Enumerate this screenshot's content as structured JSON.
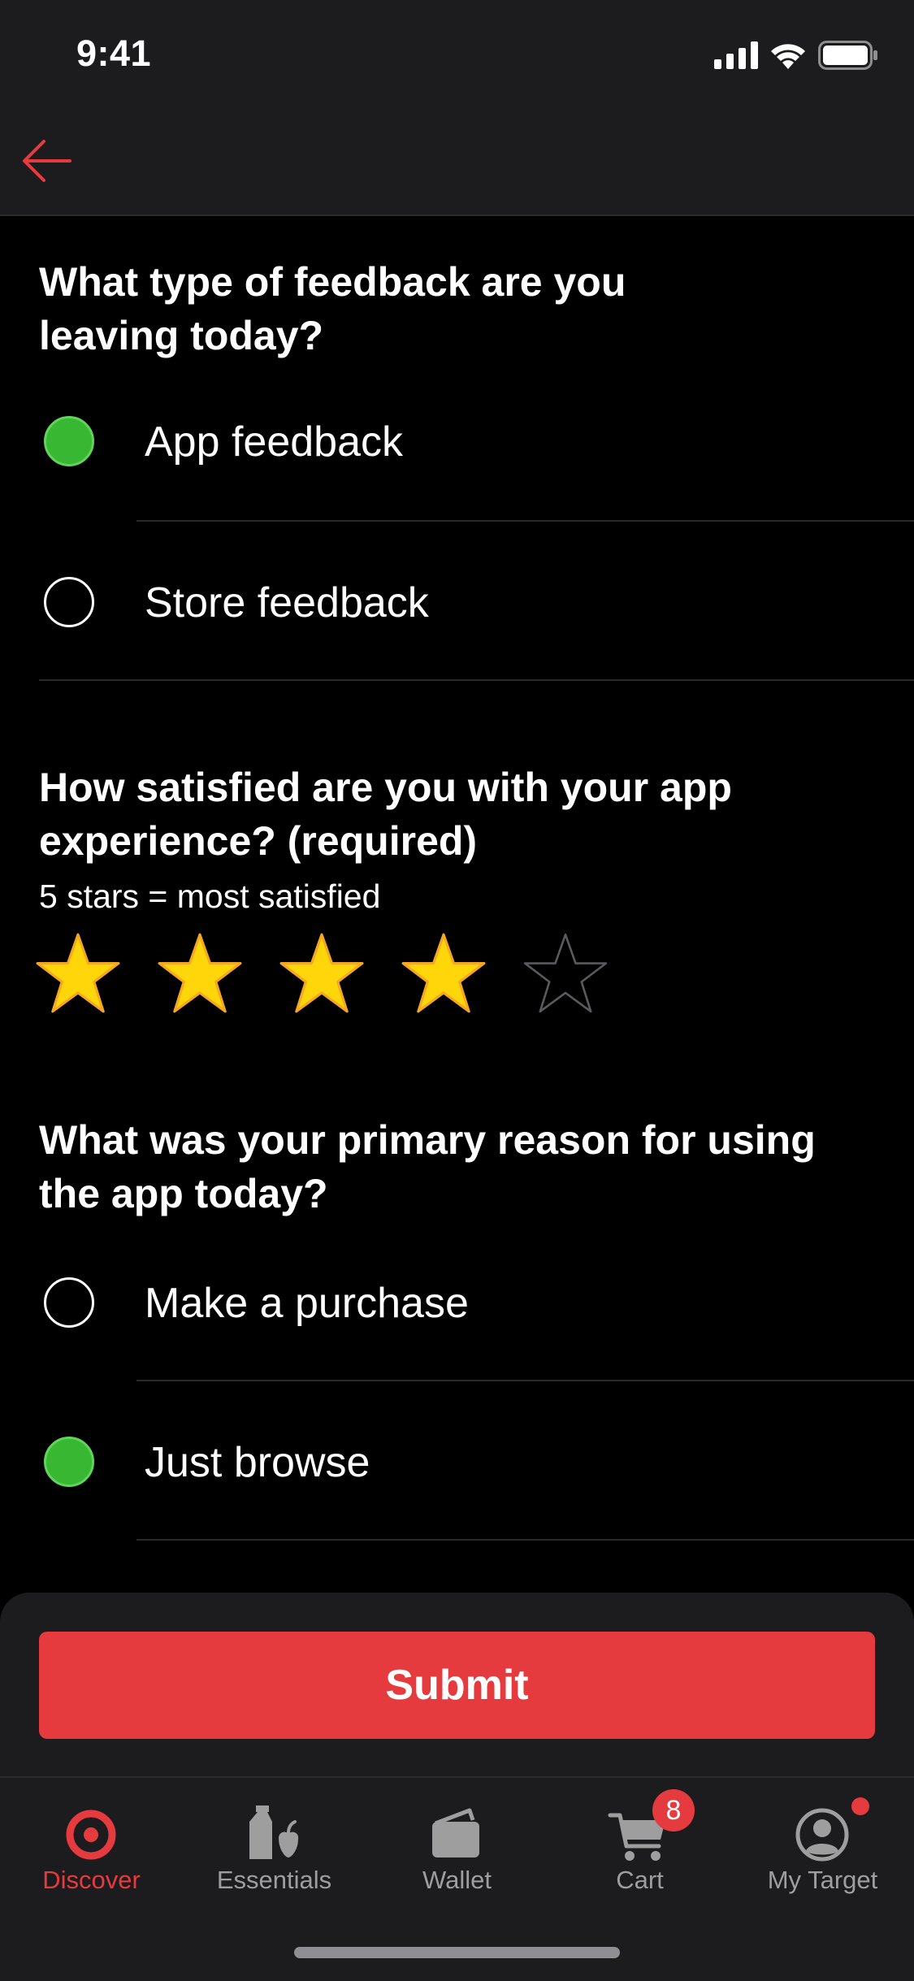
{
  "status_bar": {
    "time": "9:41"
  },
  "nav": {
    "back_icon": "arrow-left-icon",
    "accent_color": "#e63b3e"
  },
  "feedback_type": {
    "question": "What type of feedback are you leaving today?",
    "options": [
      {
        "label": "App feedback",
        "selected": true
      },
      {
        "label": "Store feedback",
        "selected": false
      }
    ]
  },
  "satisfaction": {
    "question": "How satisfied are you with your app experience? (required)",
    "hint": "5 stars = most satisfied",
    "rating": 4,
    "max_rating": 5,
    "star_fill_color": "#ffd60a"
  },
  "reason": {
    "question": "What was your primary reason for using the app today?",
    "options": [
      {
        "label": "Make a purchase",
        "selected": false
      },
      {
        "label": "Just browse",
        "selected": true
      }
    ]
  },
  "submit": {
    "label": "Submit",
    "color": "#e63b3e"
  },
  "tab_bar": {
    "tabs": [
      {
        "label": "Discover",
        "icon": "target-bullseye-icon",
        "active": true
      },
      {
        "label": "Essentials",
        "icon": "grocery-bag-icon",
        "active": false
      },
      {
        "label": "Wallet",
        "icon": "wallet-icon",
        "active": false
      },
      {
        "label": "Cart",
        "icon": "cart-icon",
        "active": false,
        "badge": "8"
      },
      {
        "label": "My Target",
        "icon": "profile-icon",
        "active": false,
        "notification_dot": true
      }
    ]
  },
  "selection_color": "#38b832"
}
